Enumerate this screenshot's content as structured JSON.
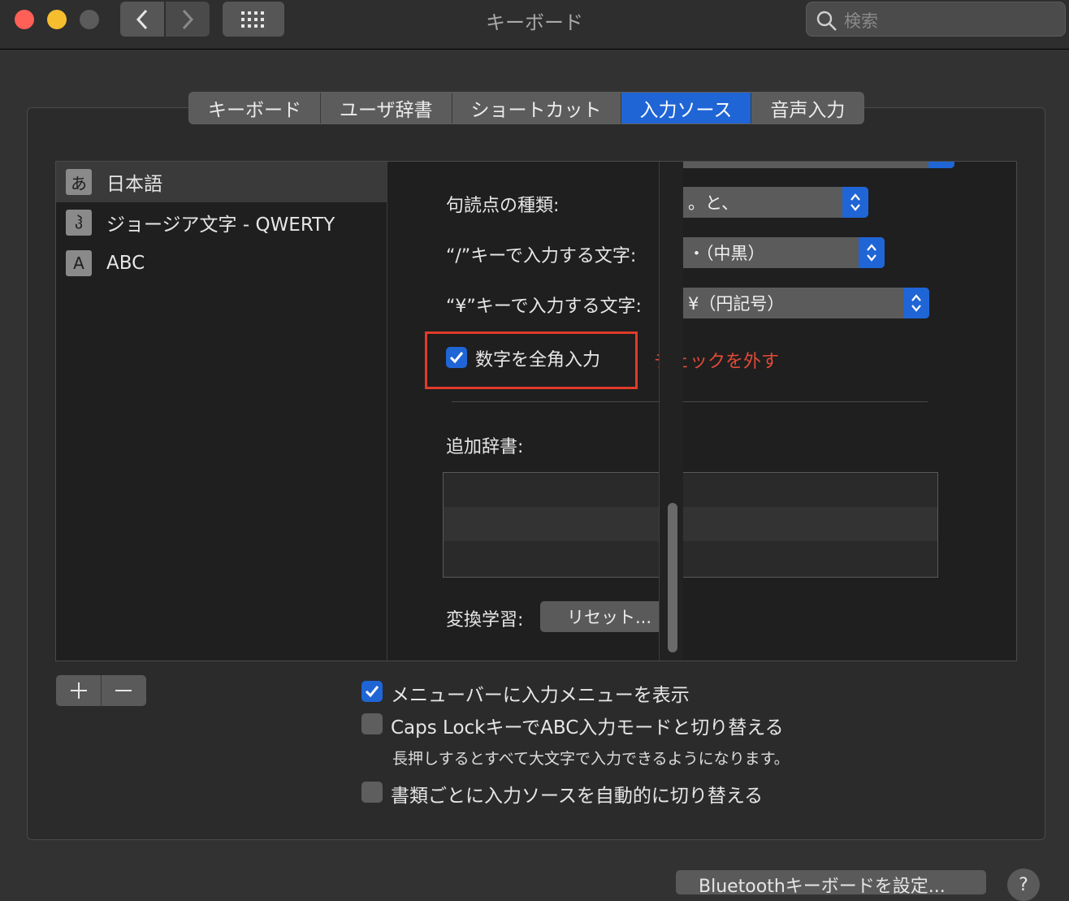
{
  "window": {
    "title": "キーボード"
  },
  "search": {
    "placeholder": "検索"
  },
  "tabs": [
    {
      "label": "キーボード"
    },
    {
      "label": "ユーザ辞書"
    },
    {
      "label": "ショートカット"
    },
    {
      "label": "入力ソース",
      "active": true
    },
    {
      "label": "音声入力"
    }
  ],
  "sources": [
    {
      "icon": "あ",
      "label": "日本語",
      "selected": true
    },
    {
      "icon": "ჰ",
      "label": "ジョージア文字 - QWERTY"
    },
    {
      "icon": "A",
      "label": "ABC"
    }
  ],
  "settings": {
    "punctuation_label": "句読点の種類:",
    "punctuation_value": "。と、",
    "slash_label": "“/”キーで入力する文字:",
    "slash_value": "・（中黒）",
    "yen_label": "“¥”キーで入力する文字:",
    "yen_value": "¥（円記号）",
    "fullwidth_label": "数字を全角入力",
    "fullwidth_checked": true,
    "annotation": "チェックを外す",
    "dict_label": "追加辞書:",
    "learning_label": "変換学習:",
    "reset_label": "リセット..."
  },
  "options": {
    "show_menu": "メニューバーに入力メニューを表示",
    "caps_lock": "Caps LockキーでABC入力モードと切り替える",
    "caps_lock_sub": "長押しするとすべて大文字で入力できるようになります。",
    "auto_switch": "書類ごとに入力ソースを自動的に切り替える"
  },
  "bottom": {
    "bluetooth_label": "Bluetoothキーボードを設定...",
    "help_label": "?"
  },
  "colors": {
    "accent": "#1f65d6",
    "annotation": "#e03b2a"
  }
}
